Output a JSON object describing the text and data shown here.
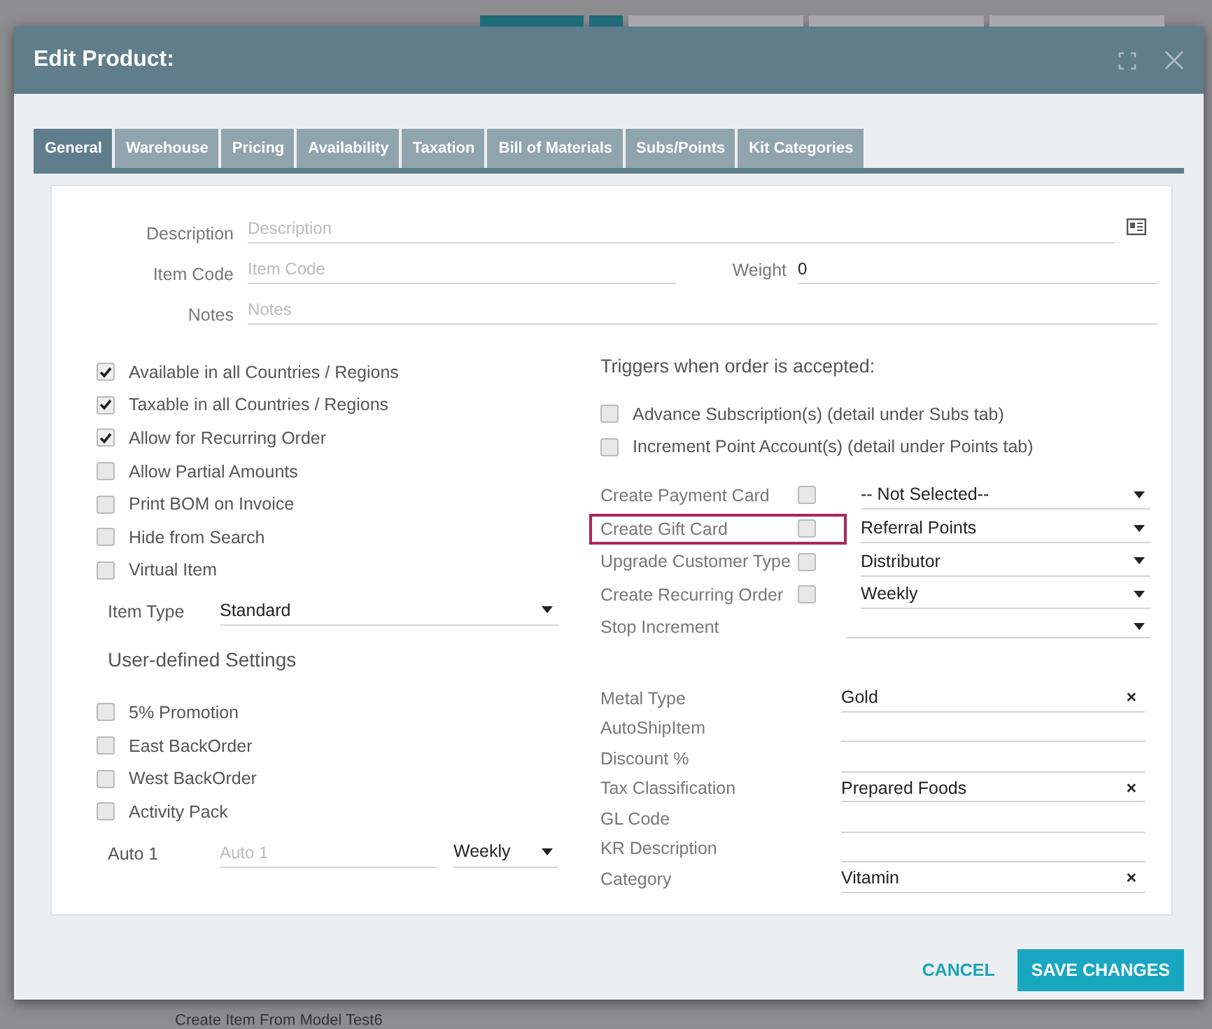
{
  "background_text": "Create Item From Model Test6",
  "window": {
    "title": "Edit Product:"
  },
  "tabs": [
    {
      "label": "General",
      "selected": true
    },
    {
      "label": "Warehouse",
      "selected": false
    },
    {
      "label": "Pricing",
      "selected": false
    },
    {
      "label": "Availability",
      "selected": false
    },
    {
      "label": "Taxation",
      "selected": false
    },
    {
      "label": "Bill of Materials",
      "selected": false
    },
    {
      "label": "Subs/Points",
      "selected": false
    },
    {
      "label": "Kit Categories",
      "selected": false
    }
  ],
  "fields": [
    {
      "label": "Description",
      "placeholder": "Description"
    },
    {
      "label": "Item Code",
      "placeholder": "Item Code"
    },
    {
      "label": "Notes",
      "placeholder": "Notes"
    }
  ],
  "weight": {
    "label": "Weight",
    "value": "0"
  },
  "options": [
    {
      "label": "Available in all Countries / Regions",
      "checked": true
    },
    {
      "label": "Taxable in all Countries / Regions",
      "checked": true
    },
    {
      "label": "Allow for Recurring Order",
      "checked": true
    },
    {
      "label": "Allow Partial Amounts",
      "checked": false
    },
    {
      "label": "Print BOM on Invoice",
      "checked": false
    },
    {
      "label": "Hide from Search",
      "checked": false
    },
    {
      "label": "Virtual Item",
      "checked": false
    }
  ],
  "item_type": {
    "label": "Item Type",
    "value": "Standard"
  },
  "user_defined": {
    "title": "User-defined Settings",
    "options": [
      {
        "label": "5% Promotion",
        "checked": false
      },
      {
        "label": "East BackOrder",
        "checked": false
      },
      {
        "label": "West BackOrder",
        "checked": false
      },
      {
        "label": "Activity Pack",
        "checked": false
      }
    ],
    "auto": {
      "label": "Auto 1",
      "placeholder": "Auto 1",
      "value": "Weekly"
    }
  },
  "triggers": {
    "title": "Triggers when order is accepted:",
    "options": [
      {
        "label": "Advance Subscription(s) (detail under Subs tab)",
        "checked": false
      },
      {
        "label": "Increment Point Account(s) (detail under Points tab)",
        "checked": false
      }
    ],
    "rows": [
      {
        "kind": "checkbox-select",
        "label": "Create Payment Card",
        "checked": false,
        "value": "-- Not Selected--",
        "highlighted": false
      },
      {
        "kind": "checkbox-select",
        "label": "Create Gift Card",
        "checked": false,
        "value": "Referral Points",
        "highlighted": true
      },
      {
        "kind": "checkbox-select",
        "label": "Upgrade Customer Type",
        "checked": false,
        "value": "Distributor",
        "highlighted": false
      },
      {
        "kind": "checkbox-select",
        "label": "Create Recurring Order",
        "checked": false,
        "value": "Weekly",
        "highlighted": false
      },
      {
        "kind": "select",
        "label": "Stop Increment",
        "highlighted": false
      }
    ]
  },
  "custom_fields": [
    {
      "label": "Metal Type",
      "value": "Gold",
      "clear": "×"
    },
    {
      "label": "AutoShipItem"
    },
    {
      "label": "Discount %"
    },
    {
      "label": "Tax Classification",
      "value": "Prepared Foods",
      "clear": "×"
    },
    {
      "label": "GL Code"
    },
    {
      "label": "KR Description"
    },
    {
      "label": "Category",
      "value": "Vitamin",
      "clear": "×"
    }
  ],
  "buttons": {
    "cancel": "CANCEL",
    "save": "SAVE CHANGES"
  }
}
